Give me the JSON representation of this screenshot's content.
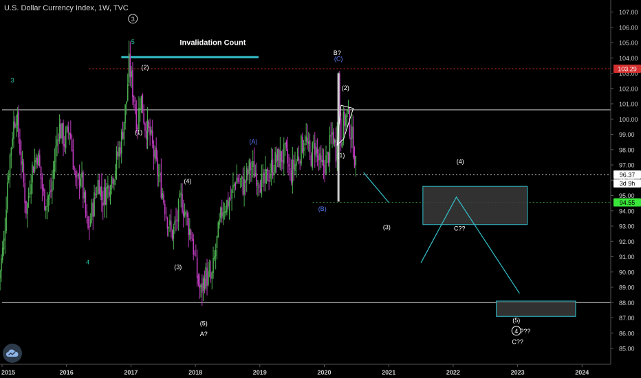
{
  "title": "U.S. Dollar Currency Index, 1W, TVC",
  "colors": {
    "background": "#000000",
    "candle_up": "#4caf50",
    "candle_down": "#c03cc0",
    "annotation_cyan": "#33c2cc",
    "red_line": "#d32f2f",
    "green_line": "#2e7d32",
    "white_line": "#cfcfcf",
    "axis_text": "#cfcfcf"
  },
  "chart_data": {
    "type": "candlestick",
    "x_axis": {
      "range": [
        2015.0,
        2024.7
      ],
      "ticks": [
        {
          "x": 2015.0,
          "label": "2015"
        },
        {
          "x": 2016.0,
          "label": "2016"
        },
        {
          "x": 2017.0,
          "label": "2017"
        },
        {
          "x": 2018.0,
          "label": "2018"
        },
        {
          "x": 2019.0,
          "label": "2019"
        },
        {
          "x": 2020.0,
          "label": "2020"
        },
        {
          "x": 2021.0,
          "label": "2021"
        },
        {
          "x": 2022.0,
          "label": "2022"
        },
        {
          "x": 2023.0,
          "label": "2023"
        },
        {
          "x": 2024.0,
          "label": "2024"
        }
      ]
    },
    "y_axis": {
      "range": [
        84.5,
        107.5
      ],
      "ticks": [
        "85.00",
        "86.00",
        "87.00",
        "88.00",
        "89.00",
        "90.00",
        "91.00",
        "92.00",
        "93.00",
        "94.00",
        "95.00",
        "96.00",
        "97.00",
        "98.00",
        "99.00",
        "100.00",
        "101.00",
        "102.00",
        "103.00",
        "104.00",
        "105.00",
        "106.00",
        "107.00"
      ]
    },
    "price_path": [
      [
        2014.95,
        89.6
      ],
      [
        2015.03,
        92.0
      ],
      [
        2015.08,
        95.8
      ],
      [
        2015.17,
        99.5
      ],
      [
        2015.22,
        100.4
      ],
      [
        2015.3,
        97.2
      ],
      [
        2015.38,
        93.9
      ],
      [
        2015.45,
        96.5
      ],
      [
        2015.55,
        97.8
      ],
      [
        2015.65,
        94.7
      ],
      [
        2015.75,
        95.0
      ],
      [
        2015.88,
        99.6
      ],
      [
        2015.97,
        98.5
      ],
      [
        2016.05,
        99.4
      ],
      [
        2016.15,
        95.5
      ],
      [
        2016.22,
        96.5
      ],
      [
        2016.33,
        92.6
      ],
      [
        2016.4,
        94.1
      ],
      [
        2016.5,
        96.1
      ],
      [
        2016.55,
        94.7
      ],
      [
        2016.65,
        95.6
      ],
      [
        2016.75,
        96.8
      ],
      [
        2016.85,
        98.6
      ],
      [
        2016.93,
        101.2
      ],
      [
        2016.97,
        103.6
      ],
      [
        2017.02,
        102.2
      ],
      [
        2017.1,
        99.6
      ],
      [
        2017.15,
        101.6
      ],
      [
        2017.22,
        99.6
      ],
      [
        2017.3,
        98.9
      ],
      [
        2017.38,
        97.1
      ],
      [
        2017.48,
        95.4
      ],
      [
        2017.55,
        93.8
      ],
      [
        2017.63,
        92.4
      ],
      [
        2017.7,
        93.2
      ],
      [
        2017.78,
        94.8
      ],
      [
        2017.88,
        93.2
      ],
      [
        2017.95,
        92.2
      ],
      [
        2018.02,
        89.9
      ],
      [
        2018.08,
        88.6
      ],
      [
        2018.15,
        89.8
      ],
      [
        2018.25,
        89.4
      ],
      [
        2018.32,
        91.6
      ],
      [
        2018.42,
        94.2
      ],
      [
        2018.55,
        94.8
      ],
      [
        2018.63,
        96.2
      ],
      [
        2018.75,
        95.6
      ],
      [
        2018.85,
        96.9
      ],
      [
        2018.97,
        96.3
      ],
      [
        2019.05,
        95.6
      ],
      [
        2019.15,
        96.6
      ],
      [
        2019.25,
        97.3
      ],
      [
        2019.4,
        97.7
      ],
      [
        2019.47,
        96.3
      ],
      [
        2019.6,
        97.6
      ],
      [
        2019.7,
        98.9
      ],
      [
        2019.78,
        97.4
      ],
      [
        2019.85,
        98.3
      ],
      [
        2019.95,
        96.7
      ],
      [
        2020.05,
        97.4
      ],
      [
        2020.13,
        99.2
      ],
      [
        2020.18,
        97.8
      ],
      [
        2020.22,
        102.8
      ],
      [
        2020.25,
        98.6
      ],
      [
        2020.3,
        99.8
      ],
      [
        2020.36,
        100.3
      ],
      [
        2020.4,
        99.4
      ],
      [
        2020.45,
        98.3
      ],
      [
        2020.5,
        96.4
      ]
    ],
    "special_candles": [
      {
        "x": 2020.22,
        "low": 94.6,
        "high": 103.0,
        "color": "#cfcfcf"
      }
    ],
    "horizontal_lines": [
      {
        "y": 103.29,
        "from": 2016.35,
        "to": 2024.7,
        "style": "dotted",
        "color": "#d32f2f"
      },
      {
        "y": 100.6,
        "from": 2015.0,
        "to": 2024.7,
        "style": "solid",
        "color": "#cfcfcf"
      },
      {
        "y": 96.37,
        "from": 2015.0,
        "to": 2024.7,
        "style": "dotted",
        "color": "#cfcfcf"
      },
      {
        "y": 94.55,
        "from": 2019.82,
        "to": 2024.7,
        "style": "dotted",
        "color": "#2e7d32"
      },
      {
        "y": 88.0,
        "from": 2015.0,
        "to": 2024.7,
        "style": "solid",
        "color": "#cfcfcf"
      },
      {
        "y": 104.05,
        "from": 2016.85,
        "to": 2018.98,
        "style": "thick",
        "color": "#33c2cc"
      }
    ],
    "trend_lines": [
      {
        "points": [
          [
            2020.61,
            96.5
          ],
          [
            2021.0,
            94.55
          ]
        ],
        "color": "#33c2cc"
      },
      {
        "points": [
          [
            2021.5,
            90.6
          ],
          [
            2022.05,
            94.9
          ],
          [
            2023.03,
            88.6
          ]
        ],
        "color": "#33c2cc"
      }
    ],
    "rectangles": [
      {
        "x1": 2021.53,
        "x2": 2023.15,
        "y1": 93.1,
        "y2": 95.6
      },
      {
        "x1": 2022.67,
        "x2": 2023.9,
        "y1": 87.1,
        "y2": 88.1
      }
    ],
    "wedge": [
      [
        2020.2,
        98.3
      ],
      [
        2020.26,
        100.9
      ],
      [
        2020.45,
        100.7
      ],
      [
        2020.3,
        98.7
      ]
    ],
    "wave_labels": [
      {
        "text": "3",
        "x": 2017.03,
        "y": 106.4,
        "circled": true,
        "color": "#cfcfcf"
      },
      {
        "text": "5",
        "x": 2017.03,
        "y": 104.9,
        "circled": false,
        "color": "#26c6a6"
      },
      {
        "text": "3",
        "x": 2015.16,
        "y": 102.4,
        "circled": false,
        "color": "#26c6a6"
      },
      {
        "text": "4",
        "x": 2016.33,
        "y": 90.5,
        "circled": false,
        "color": "#26c6a6"
      },
      {
        "text": "(2)",
        "x": 2017.22,
        "y": 103.25,
        "circled": false,
        "color": "#ffffff"
      },
      {
        "text": "(1)",
        "x": 2017.12,
        "y": 99.0,
        "circled": false,
        "color": "#ffffff"
      },
      {
        "text": "(4)",
        "x": 2017.88,
        "y": 95.8,
        "circled": false,
        "color": "#ffffff"
      },
      {
        "text": "(3)",
        "x": 2017.73,
        "y": 90.2,
        "circled": false,
        "color": "#ffffff"
      },
      {
        "text": "(5)",
        "x": 2018.13,
        "y": 86.5,
        "circled": false,
        "color": "#ffffff"
      },
      {
        "text": "A?",
        "x": 2018.13,
        "y": 85.8,
        "circled": false,
        "color": "#ffffff"
      },
      {
        "text": "(A)",
        "x": 2018.9,
        "y": 98.4,
        "circled": false,
        "color": "#5c7cfa"
      },
      {
        "text": "(B)",
        "x": 2019.97,
        "y": 94.0,
        "circled": false,
        "color": "#5c7cfa"
      },
      {
        "text": "B?",
        "x": 2020.2,
        "y": 104.2,
        "circled": false,
        "color": "#ffffff"
      },
      {
        "text": "(C)",
        "x": 2020.22,
        "y": 103.8,
        "circled": false,
        "color": "#5c7cfa"
      },
      {
        "text": "(2)",
        "x": 2020.33,
        "y": 101.9,
        "circled": false,
        "color": "#ffffff"
      },
      {
        "text": "(1)",
        "x": 2020.26,
        "y": 97.5,
        "circled": false,
        "color": "#ffffff"
      },
      {
        "text": "(4)",
        "x": 2022.11,
        "y": 97.1,
        "circled": false,
        "color": "#ffffff"
      },
      {
        "text": "(3)",
        "x": 2020.97,
        "y": 92.8,
        "circled": false,
        "color": "#ffffff"
      },
      {
        "text": "C??",
        "x": 2022.1,
        "y": 92.7,
        "circled": false,
        "color": "#ffffff"
      },
      {
        "text": "(5)",
        "x": 2022.98,
        "y": 86.7,
        "circled": false,
        "color": "#ffffff"
      },
      {
        "text": "4",
        "x": 2022.98,
        "y": 86.0,
        "circled": true,
        "color": "#ffffff"
      },
      {
        "text": "???",
        "x": 2023.12,
        "y": 86.0,
        "circled": false,
        "color": "#ffffff"
      },
      {
        "text": "C??",
        "x": 2023.0,
        "y": 85.3,
        "circled": false,
        "color": "#ffffff"
      }
    ],
    "annotations": [
      {
        "text": "Invalidation Count",
        "x": 2018.27,
        "y": 104.85
      }
    ],
    "price_tags": [
      {
        "value": "103.29",
        "y": 103.29,
        "bg": "#d32f2f",
        "fg": "#ffffff"
      },
      {
        "value": "96.37",
        "y": 96.37,
        "bg": "#ffffff",
        "fg": "#000000"
      },
      {
        "value": "3d 9h",
        "y": 95.8,
        "bg": "#ffffff",
        "fg": "#000000"
      },
      {
        "value": "94.55",
        "y": 94.55,
        "bg": "#39e639",
        "fg": "#000000"
      }
    ]
  }
}
